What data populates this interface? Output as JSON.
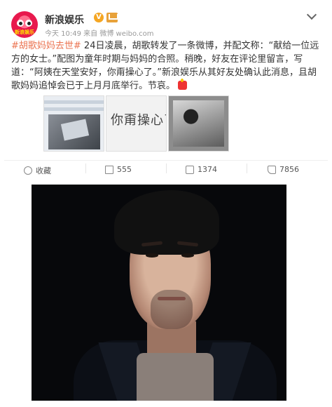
{
  "post": {
    "author": "新浪娱乐",
    "avatar_text": "新浪娱乐",
    "meta": "今天 10:49 来自 微博 weibo.com",
    "hashtag": "#胡歌妈妈去世#",
    "content": " 24日凌晨，胡歌转发了一条微博，并配文称：“献给一位远方的女士。”配图为童年时期与妈妈的合照。稍晚，好友在评论里留言，写道：“阿姨在天堂安好，你甭操心了。”新浪娱乐从其好友处确认此消息，且胡歌妈妈追悼会已于上月月底举行。节哀。",
    "thumb_text": "你甭操心了"
  },
  "actions": [
    {
      "label": "收藏",
      "icon": "star-icon"
    },
    {
      "label": "555",
      "icon": "share-icon"
    },
    {
      "label": "1374",
      "icon": "comment-icon"
    },
    {
      "label": "7856",
      "icon": "like-icon"
    }
  ]
}
